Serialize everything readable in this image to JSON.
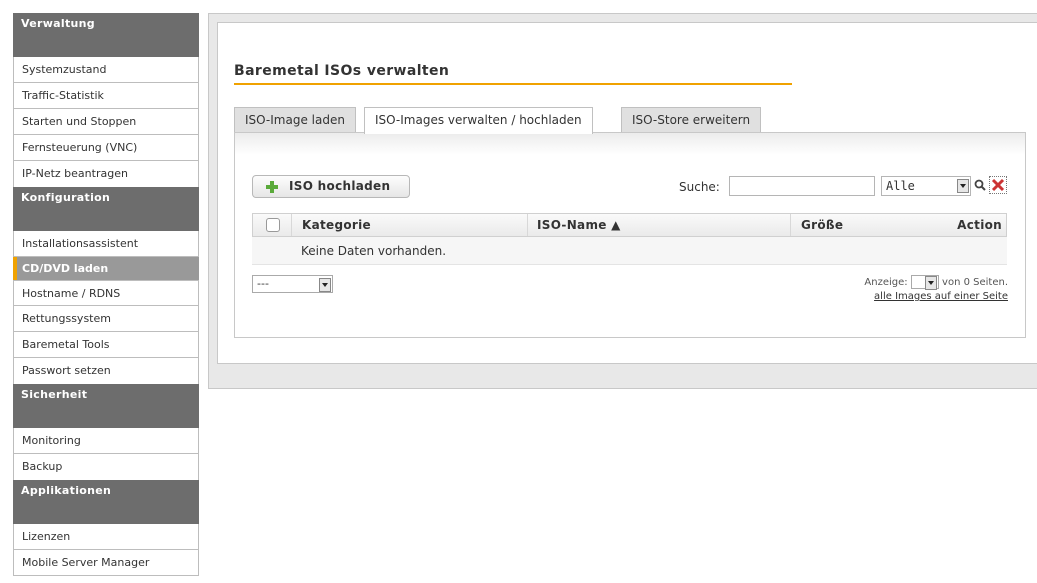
{
  "sidebar": {
    "sections": [
      {
        "title": "Verwaltung",
        "items": [
          "Systemzustand",
          "Traffic-Statistik",
          "Starten und Stoppen",
          "Fernsteuerung (VNC)",
          "IP-Netz beantragen"
        ]
      },
      {
        "title": "Konfiguration",
        "items": [
          "Installationsassistent",
          "CD/DVD laden",
          "Hostname / RDNS",
          "Rettungssystem",
          "Baremetal Tools",
          "Passwort setzen"
        ]
      },
      {
        "title": "Sicherheit",
        "items": [
          "Monitoring",
          "Backup"
        ]
      },
      {
        "title": "Applikationen",
        "items": [
          "Lizenzen",
          "Mobile Server Manager"
        ]
      }
    ],
    "active_item": "CD/DVD laden"
  },
  "page": {
    "title": "Baremetal ISOs verwalten"
  },
  "tabs": [
    {
      "label": "ISO-Image laden",
      "active": false
    },
    {
      "label": "ISO-Images verwalten / hochladen",
      "active": true
    },
    {
      "label": "ISO-Store erweitern",
      "active": false
    }
  ],
  "toolbar": {
    "upload_label": "ISO hochladen",
    "search_label": "Suche:",
    "search_value": "",
    "filter_value": "Alle"
  },
  "table": {
    "columns": [
      "Kategorie",
      "ISO-Name ▲",
      "Größe",
      "Action"
    ],
    "empty_message": "Keine Daten vorhanden."
  },
  "pagination": {
    "per_page_value": "---",
    "display_label": "Anzeige:",
    "page_value": "",
    "of_pages": "von 0 Seiten.",
    "all_link": "alle Images auf einer Seite"
  },
  "colors": {
    "accent": "#f0a200",
    "section_header": "#6d6d6d",
    "active_item": "#999999",
    "plus_icon": "#5aaa3a",
    "clear_icon": "#cc3333"
  }
}
